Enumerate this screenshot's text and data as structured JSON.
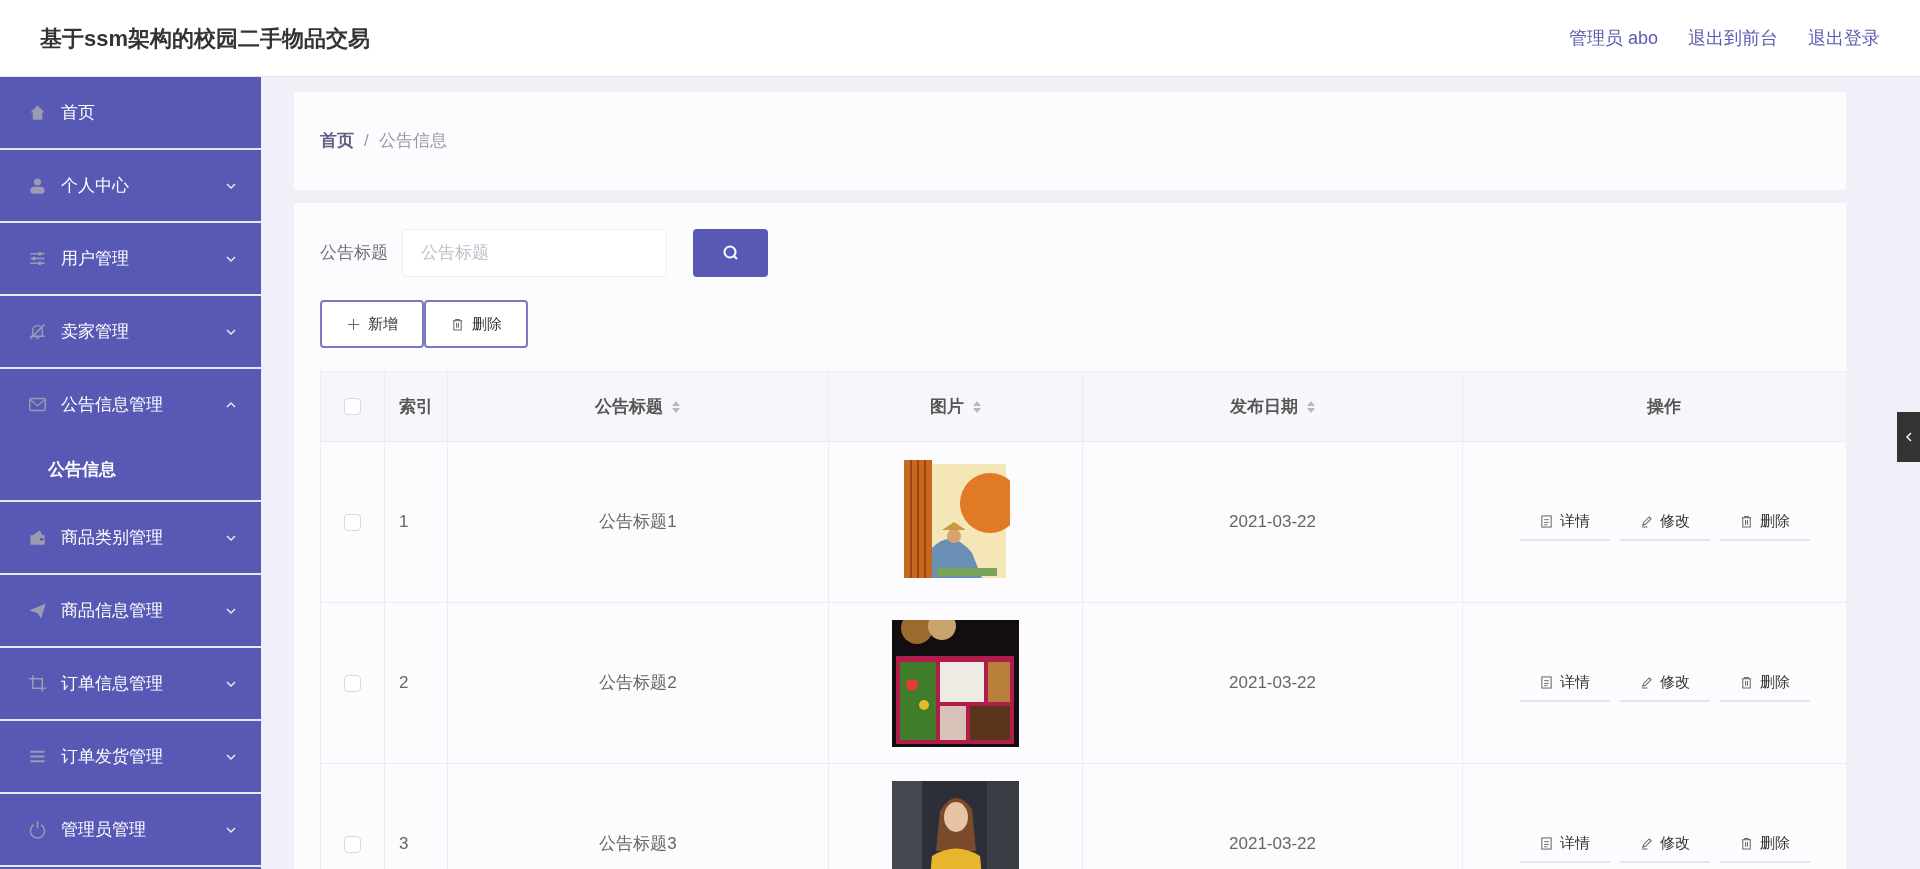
{
  "header": {
    "title": "基于ssm架构的校园二手物品交易",
    "links": [
      "管理员 abo",
      "退出到前台",
      "退出登录"
    ]
  },
  "sidebar": {
    "items": [
      {
        "kind": "link",
        "label": "首页"
      },
      {
        "kind": "menu",
        "label": "个人中心",
        "expanded": false
      },
      {
        "kind": "menu",
        "label": "用户管理",
        "expanded": false
      },
      {
        "kind": "menu",
        "label": "卖家管理",
        "expanded": false
      },
      {
        "kind": "menu",
        "label": "公告信息管理",
        "expanded": true,
        "children": [
          {
            "label": "公告信息",
            "selected": true
          }
        ]
      },
      {
        "kind": "menu",
        "label": "商品类别管理",
        "expanded": false
      },
      {
        "kind": "menu",
        "label": "商品信息管理",
        "expanded": false
      },
      {
        "kind": "menu",
        "label": "订单信息管理",
        "expanded": false
      },
      {
        "kind": "menu",
        "label": "订单发货管理",
        "expanded": false
      },
      {
        "kind": "menu",
        "label": "管理员管理",
        "expanded": false
      }
    ]
  },
  "breadcrumb": [
    "首页",
    "/",
    "公告信息"
  ],
  "search": {
    "label": "公告标题",
    "placeholder": "公告标题"
  },
  "toolbar": [
    {
      "kind": "add",
      "label": "新增"
    },
    {
      "kind": "delete",
      "label": "删除"
    }
  ],
  "table": {
    "all_checked": false,
    "columns": [
      {
        "label": "索引",
        "sortable": false
      },
      {
        "label": "公告标题",
        "sortable": true
      },
      {
        "label": "图片",
        "sortable": true
      },
      {
        "label": "发布日期",
        "sortable": true
      },
      {
        "label": "操作",
        "sortable": false
      }
    ],
    "rows": [
      {
        "selected": false,
        "index": "1",
        "title": "公告标题1",
        "date": "2021-03-22",
        "actions": [
          {
            "kind": "detail",
            "label": "详情"
          },
          {
            "kind": "edit",
            "label": "修改"
          },
          {
            "kind": "delete",
            "label": "删除"
          }
        ]
      },
      {
        "selected": false,
        "index": "2",
        "title": "公告标题2",
        "date": "2021-03-22",
        "actions": [
          {
            "kind": "detail",
            "label": "详情"
          },
          {
            "kind": "edit",
            "label": "修改"
          },
          {
            "kind": "delete",
            "label": "删除"
          }
        ]
      },
      {
        "selected": false,
        "index": "3",
        "title": "公告标题3",
        "date": "2021-03-22",
        "actions": [
          {
            "kind": "detail",
            "label": "详情"
          },
          {
            "kind": "edit",
            "label": "修改"
          },
          {
            "kind": "delete",
            "label": "删除"
          }
        ]
      }
    ]
  }
}
